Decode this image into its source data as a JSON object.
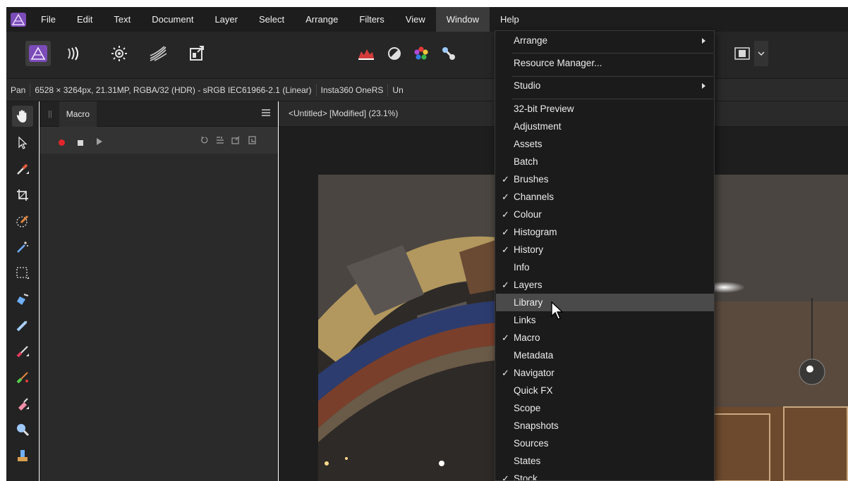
{
  "menubar": {
    "items": [
      "File",
      "Edit",
      "Text",
      "Document",
      "Layer",
      "Select",
      "Arrange",
      "Filters",
      "View",
      "Window",
      "Help"
    ],
    "active": "Window"
  },
  "contextbar": {
    "tool": "Pan",
    "doc_info": "6528 × 3264px, 21.31MP, RGBA/32 (HDR) - sRGB IEC61966-2.1 (Linear)",
    "camera": "Insta360 OneRS",
    "trailing": "Un"
  },
  "panel": {
    "title": "Macro"
  },
  "document": {
    "tab_label": "<Untitled> [Modified] (23.1%)"
  },
  "window_menu": {
    "items": [
      {
        "label": "Arrange",
        "checked": false,
        "submenu": true
      },
      {
        "label": "Resource Manager...",
        "checked": false,
        "submenu": false
      },
      {
        "label": "Studio",
        "checked": false,
        "submenu": true
      },
      {
        "label": "32-bit Preview",
        "checked": false
      },
      {
        "label": "Adjustment",
        "checked": false
      },
      {
        "label": "Assets",
        "checked": false
      },
      {
        "label": "Batch",
        "checked": false
      },
      {
        "label": "Brushes",
        "checked": true
      },
      {
        "label": "Channels",
        "checked": true
      },
      {
        "label": "Colour",
        "checked": true
      },
      {
        "label": "Histogram",
        "checked": true
      },
      {
        "label": "History",
        "checked": true
      },
      {
        "label": "Info",
        "checked": false
      },
      {
        "label": "Layers",
        "checked": true
      },
      {
        "label": "Library",
        "checked": false,
        "highlighted": true
      },
      {
        "label": "Links",
        "checked": false
      },
      {
        "label": "Macro",
        "checked": true
      },
      {
        "label": "Metadata",
        "checked": false
      },
      {
        "label": "Navigator",
        "checked": true
      },
      {
        "label": "Quick FX",
        "checked": false
      },
      {
        "label": "Scope",
        "checked": false
      },
      {
        "label": "Snapshots",
        "checked": false
      },
      {
        "label": "Sources",
        "checked": false
      },
      {
        "label": "States",
        "checked": false
      },
      {
        "label": "Stock",
        "checked": true
      }
    ],
    "check_glyph": "✓"
  },
  "colors": {
    "menubar_bg": "#1d1d1d",
    "menu_bg": "#1b1b1b",
    "highlight": "#4a4a4a",
    "record": "#e0262b"
  }
}
